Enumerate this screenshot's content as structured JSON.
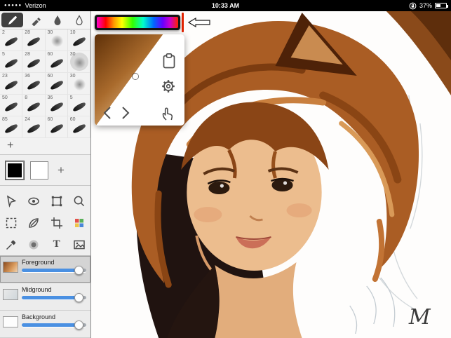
{
  "status_bar": {
    "carrier": "Verizon",
    "time": "10:33 AM",
    "battery_percent": "37%"
  },
  "icons": {
    "signal_dots": "●●●●●"
  },
  "brush_panel": {
    "rows": [
      [
        "2",
        "28",
        "30",
        "10"
      ],
      [
        "5",
        "28",
        "60",
        "30"
      ],
      [
        "23",
        "36",
        "60",
        "30"
      ],
      [
        "50",
        "8",
        "36",
        "5"
      ],
      [
        "85",
        "24",
        "60",
        "60"
      ]
    ],
    "selected_brush": "30",
    "add_label": "+"
  },
  "color_swatches": {
    "foreground_color": "#000000",
    "background_color": "#ffffff",
    "add_label": "+"
  },
  "tools_grid": {
    "text_tool_glyph": "T"
  },
  "layers": {
    "items": [
      {
        "label": "Foreground",
        "selected": true,
        "slider_percent": 88
      },
      {
        "label": "Midground",
        "selected": false,
        "slider_percent": 88
      },
      {
        "label": "Background",
        "selected": false,
        "slider_percent": 88
      }
    ],
    "slider_accent": "#4a90e2"
  },
  "hue_bar": {
    "gradient": [
      "#ff00cc",
      "#ff0000",
      "#ff9900",
      "#ffff00",
      "#33ff00",
      "#00ffcc",
      "#0066ff",
      "#6600ff",
      "#cc00cc",
      "#ff2200"
    ],
    "marker_color": "#e02200"
  },
  "color_picker": {
    "gradient_dark": "#5e3008",
    "gradient_mid": "#a96a2c",
    "gradient_light": "#ffffff"
  },
  "canvas": {
    "signature": "M"
  }
}
